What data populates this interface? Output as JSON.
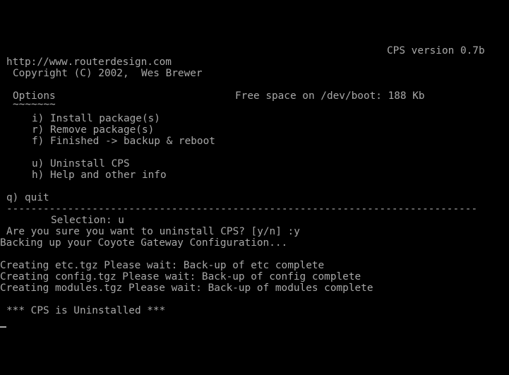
{
  "theme": {
    "background": "#000000",
    "foreground": "#a8a8a8"
  },
  "header": {
    "version": "CPS version 0.7b",
    "url": "http://www.routerdesign.com",
    "copyright": "Copyright (C) 2002,  Wes Brewer"
  },
  "menu": {
    "title": "Options",
    "underline": "~~~~~~~",
    "free_space": "Free space on /dev/boot: 188 Kb",
    "items": [
      {
        "key": "i",
        "text": "i) Install package(s)"
      },
      {
        "key": "r",
        "text": "r) Remove package(s)"
      },
      {
        "key": "f",
        "text": "f) Finished -> backup & reboot"
      },
      {
        "key": "u",
        "text": "u) Uninstall CPS"
      },
      {
        "key": "h",
        "text": "h) Help and other info"
      }
    ],
    "quit": "q) quit"
  },
  "separator": "---------------------------------------------------------------------",
  "session": {
    "selection": "Selection: u",
    "confirm": "Are you sure you want to uninstall CPS? [y/n] :y",
    "backing_up": "Backing up your Coyote Gateway Configuration...",
    "creating": [
      "Creating etc.tgz Please wait: Back-up of etc complete",
      "Creating config.tgz Please wait: Back-up of config complete",
      "Creating modules.tgz Please wait: Back-up of modules complete"
    ],
    "result": "*** CPS is Uninstalled ***"
  }
}
